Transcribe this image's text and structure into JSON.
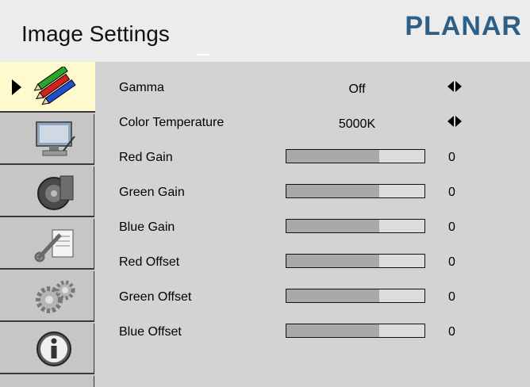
{
  "header": {
    "title": "Image Settings",
    "brand": "PLANAR",
    "brand_color": "#2e5f86"
  },
  "sidebar": {
    "items": [
      {
        "icon": "color-pencils-icon",
        "active": true
      },
      {
        "icon": "display-settings-icon",
        "active": false
      },
      {
        "icon": "speaker-icon",
        "active": false
      },
      {
        "icon": "tools-icon",
        "active": false
      },
      {
        "icon": "gears-icon",
        "active": false
      },
      {
        "icon": "info-icon",
        "active": false
      }
    ]
  },
  "settings": [
    {
      "label": "Gamma",
      "value": "Off",
      "type": "select"
    },
    {
      "label": "Color Temperature",
      "value": "5000K",
      "type": "select"
    },
    {
      "label": "Red Gain",
      "value": "0",
      "type": "slider",
      "level_percent": 67
    },
    {
      "label": "Green Gain",
      "value": "0",
      "type": "slider",
      "level_percent": 67
    },
    {
      "label": "Blue Gain",
      "value": "0",
      "type": "slider",
      "level_percent": 67
    },
    {
      "label": "Red Offset",
      "value": "0",
      "type": "slider",
      "level_percent": 67
    },
    {
      "label": "Green Offset",
      "value": "0",
      "type": "slider",
      "level_percent": 67
    },
    {
      "label": "Blue Offset",
      "value": "0",
      "type": "slider",
      "level_percent": 67
    }
  ]
}
